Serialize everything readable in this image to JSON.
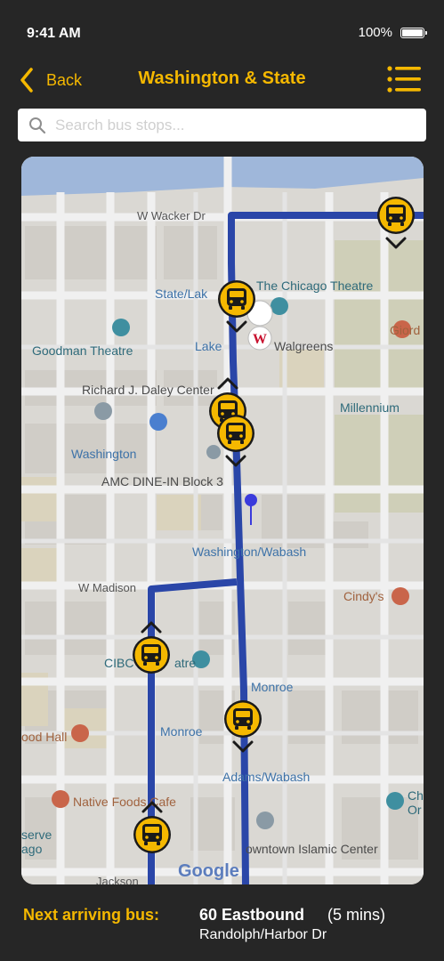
{
  "status_bar": {
    "time": "9:41 AM",
    "battery": "100%"
  },
  "nav": {
    "back_label": "Back",
    "title": "Washington & State",
    "icons": [
      "chevron-left-icon",
      "list-menu-icon"
    ]
  },
  "search": {
    "placeholder": "Search bus stops...",
    "value": ""
  },
  "map": {
    "labels": {
      "w_wacker": "W Wacker Dr",
      "state_lake": "State/Lak",
      "chicago_theatre": "The Chicago Theatre",
      "goodman": "Goodman Theatre",
      "lake": "Lake",
      "walgreens": "Walgreens",
      "giord": "Giord",
      "daley": "Richard J. Daley Center",
      "millennium": "Millennium",
      "washington": "Washington",
      "amc": "AMC DINE-IN Block 3",
      "washington_wabash": "Washington/Wabash",
      "w_madison": "W Madison",
      "cindys": "Cindy's",
      "cibc": "CIBC",
      "cibc_tail": "atre",
      "monroe_right": "Monroe",
      "monroe_left": "Monroe",
      "food_hall": "ood Hall",
      "adams_wabash": "Adams/Wabash",
      "native_foods": "Native Foods Cafe",
      "serve": "serve",
      "ago": "ago",
      "islamic_center": "owntown Islamic Center",
      "chi": "Ch",
      "orc": "Or",
      "jackson": "Jackson",
      "google": "Google"
    },
    "bus_markers": [
      {
        "name": "bus-marker-1",
        "direction": "down"
      },
      {
        "name": "bus-marker-2",
        "direction": "down"
      },
      {
        "name": "bus-marker-3",
        "direction": "up"
      },
      {
        "name": "bus-marker-4",
        "direction": "down"
      },
      {
        "name": "bus-marker-5",
        "direction": "up"
      },
      {
        "name": "bus-marker-6",
        "direction": "down"
      },
      {
        "name": "bus-marker-7",
        "direction": "up"
      }
    ],
    "colors": {
      "route": "#2a46a8",
      "marker": "#f5b800",
      "water": "#a9c3e8",
      "park": "#dfdcc4",
      "current_location": "#3b3bdc"
    }
  },
  "next_bus": {
    "label": "Next arriving bus:",
    "route": "60 Eastbound",
    "eta": "(5 mins)",
    "destination": "Randolph/Harbor Dr"
  },
  "colors": {
    "accent": "#f5b800",
    "background": "#262626"
  }
}
